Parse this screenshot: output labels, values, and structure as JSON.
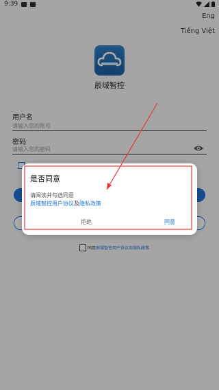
{
  "status_bar": {
    "time": "9:39"
  },
  "languages": {
    "eng": "Eng",
    "viet": "Tiếng Việt"
  },
  "app": {
    "logo_icon": "cloud-logo-icon",
    "name": "辰域智控"
  },
  "form": {
    "username_label": "用户名",
    "username_placeholder": "请输入您的账号",
    "password_label": "密码",
    "password_placeholder": "请输入您的密码"
  },
  "footer": {
    "agree_prefix": "同意",
    "agree_link": "辰域智控用户协议及隐私政策"
  },
  "dialog": {
    "title": "是否同意",
    "message": "请阅读并勾选同意",
    "link_user_agreement": "辰域智控用户协议",
    "link_separator": "及",
    "link_privacy": "隐私政策",
    "reject_label": "拒绝",
    "agree_label": "同意"
  },
  "colors": {
    "accent": "#1e74d6",
    "annotation": "#e8363a"
  }
}
